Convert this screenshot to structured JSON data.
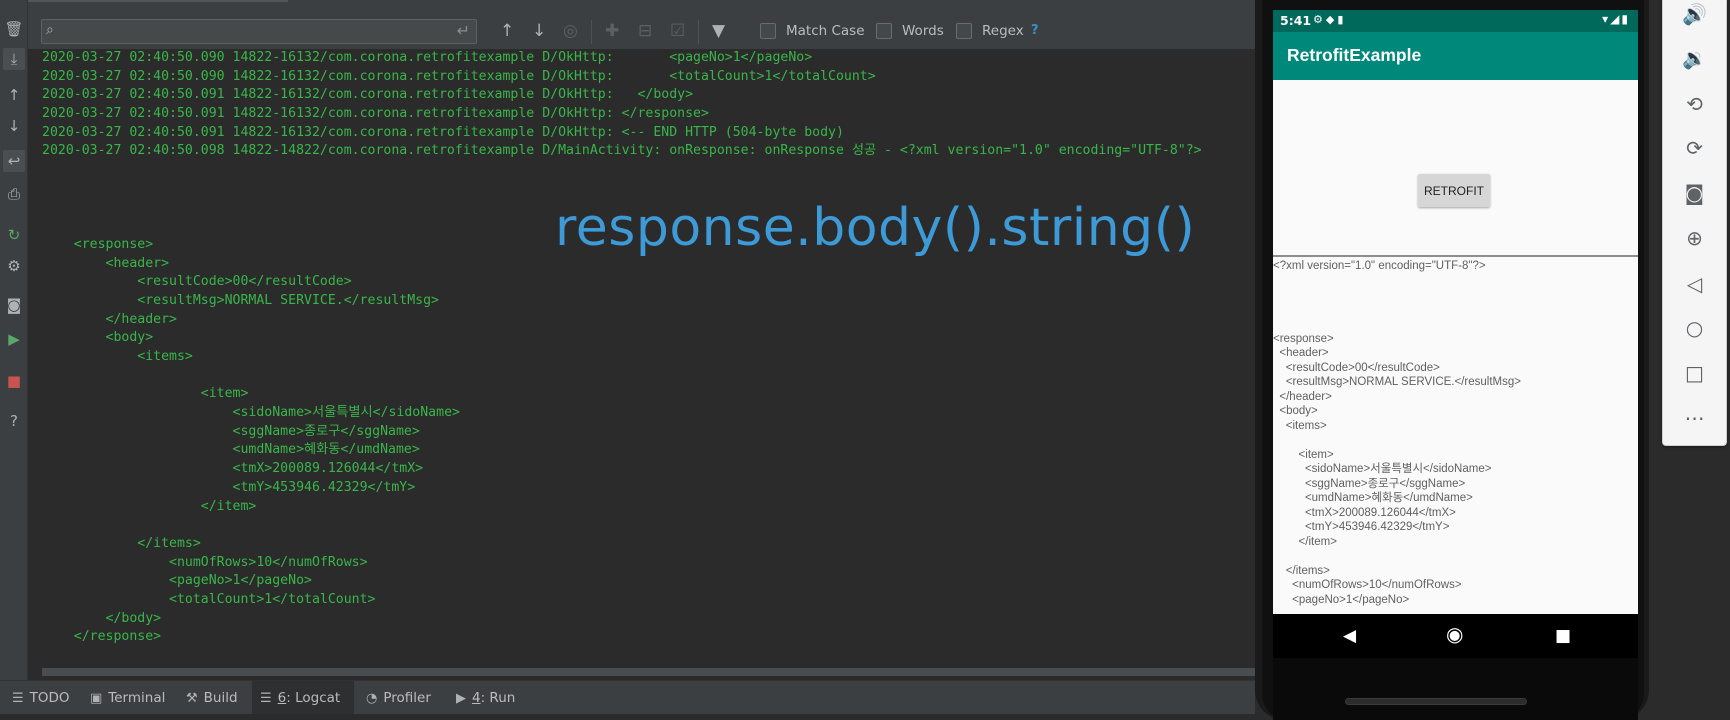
{
  "logcat_toolbar": {
    "search_placeholder": "",
    "match_case_label": "Match Case",
    "words_label": "Words",
    "regex_label": "Regex",
    "help_label": "?"
  },
  "log_lines": [
    "2020-03-27 02:40:50.090 14822-16132/com.corona.retrofitexample D/OkHttp:       <pageNo>1</pageNo>",
    "2020-03-27 02:40:50.090 14822-16132/com.corona.retrofitexample D/OkHttp:       <totalCount>1</totalCount>",
    "2020-03-27 02:40:50.091 14822-16132/com.corona.retrofitexample D/OkHttp:   </body>",
    "2020-03-27 02:40:50.091 14822-16132/com.corona.retrofitexample D/OkHttp: </response>",
    "2020-03-27 02:40:50.091 14822-16132/com.corona.retrofitexample D/OkHttp: <-- END HTTP (504-byte body)",
    "2020-03-27 02:40:50.098 14822-14822/com.corona.retrofitexample D/MainActivity: onResponse: onResponse 성공 - <?xml version=\"1.0\" encoding=\"UTF-8\"?>",
    "",
    "",
    "",
    "",
    "    <response>",
    "        <header>",
    "            <resultCode>00</resultCode>",
    "            <resultMsg>NORMAL SERVICE.</resultMsg>",
    "        </header>",
    "        <body>",
    "            <items>",
    "",
    "                    <item>",
    "                        <sidoName>서울특별시</sidoName>",
    "                        <sggName>종로구</sggName>",
    "                        <umdName>혜화동</umdName>",
    "                        <tmX>200089.126044</tmX>",
    "                        <tmY>453946.42329</tmY>",
    "                    </item>",
    "",
    "            </items>",
    "                <numOfRows>10</numOfRows>",
    "                <pageNo>1</pageNo>",
    "                <totalCount>1</totalCount>",
    "        </body>",
    "    </response>"
  ],
  "overlay_caption": "response.body().string()",
  "bottom_tabs": [
    {
      "label": "TODO",
      "icon": "list-icon"
    },
    {
      "label": "Terminal",
      "icon": "terminal-icon"
    },
    {
      "label": "Build",
      "icon": "hammer-icon"
    },
    {
      "prefix": "6",
      "label": ": Logcat",
      "icon": "logcat-icon",
      "active": true
    },
    {
      "label": "Profiler",
      "icon": "gauge-icon"
    },
    {
      "prefix": "4",
      "label": ": Run",
      "icon": "play-icon"
    }
  ],
  "phone": {
    "status_time": "5:41",
    "app_title": "RetrofitExample",
    "button_label": "RETROFIT",
    "response_lines": [
      "<?xml version=\"1.0\" encoding=\"UTF-8\"?>",
      "",
      "",
      "",
      "",
      "<response>",
      "  <header>",
      "    <resultCode>00</resultCode>",
      "    <resultMsg>NORMAL SERVICE.</resultMsg>",
      "  </header>",
      "  <body>",
      "    <items>",
      "",
      "        <item>",
      "          <sidoName>서울특별시</sidoName>",
      "          <sggName>종로구</sggName>",
      "          <umdName>혜화동</umdName>",
      "          <tmX>200089.126044</tmX>",
      "          <tmY>453946.42329</tmY>",
      "        </item>",
      "",
      "    </items>",
      "      <numOfRows>10</numOfRows>",
      "      <pageNo>1</pageNo>"
    ]
  },
  "colors": {
    "log_text": "#39b54a",
    "caption": "#3d9ad6",
    "app_bar": "#00897b",
    "status_bar": "#00695c"
  }
}
